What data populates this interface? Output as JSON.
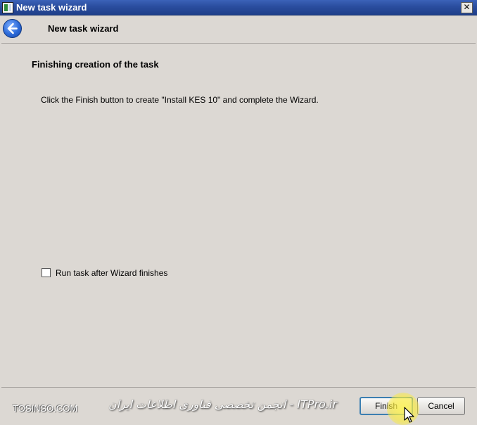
{
  "window": {
    "title": "New task wizard",
    "close_glyph": "✕"
  },
  "header": {
    "title": "New task wizard",
    "back_icon": "back-arrow-icon"
  },
  "content": {
    "heading": "Finishing creation of the task",
    "description": "Click the Finish button to create \"Install KES 10\" and complete the Wizard.",
    "run_after_label": "Run task after Wizard finishes",
    "run_after_checked": false
  },
  "footer": {
    "watermark_left": "TOSINSO.COM",
    "watermark_mid": "انجمن تخصصی فناوری اطلاعات ایران - ITPro.ir",
    "finish_label": "Finish",
    "cancel_label": "Cancel"
  },
  "colors": {
    "titlebar": "#2a4d9e",
    "window_bg": "#dcd8d3",
    "focus_border": "#3c7fb1",
    "cursor_highlight": "#f5e84a"
  }
}
